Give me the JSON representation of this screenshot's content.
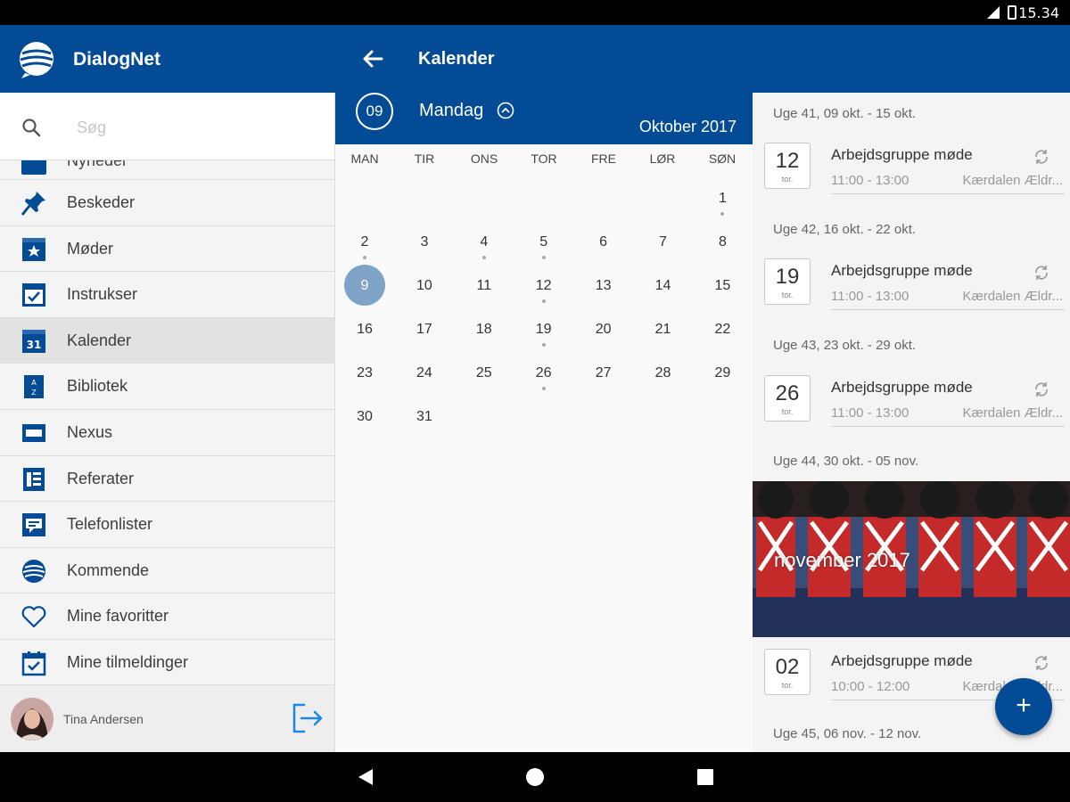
{
  "status_bar": {
    "time": "15.34"
  },
  "app_bar": {
    "app_name": "DialogNet",
    "screen_title": "Kalender"
  },
  "search": {
    "placeholder": "Søg"
  },
  "drawer": {
    "partial_item_label": "Nyheder",
    "items": [
      {
        "label": "Beskeder",
        "icon": "pin-icon"
      },
      {
        "label": "Møder",
        "icon": "meeting-icon"
      },
      {
        "label": "Instrukser",
        "icon": "checklist-icon"
      },
      {
        "label": "Kalender",
        "icon": "calendar-icon",
        "active": true
      },
      {
        "label": "Bibliotek",
        "icon": "library-icon"
      },
      {
        "label": "Nexus",
        "icon": "nexus-icon"
      },
      {
        "label": "Referater",
        "icon": "minutes-icon"
      },
      {
        "label": "Telefonlister",
        "icon": "phone-list-icon"
      },
      {
        "label": "Kommende",
        "icon": "upcoming-icon"
      },
      {
        "label": "Mine favoritter",
        "icon": "heart-icon"
      },
      {
        "label": "Mine tilmeldinger",
        "icon": "calendar-check-icon"
      }
    ],
    "user": {
      "name": "Tina Andersen"
    }
  },
  "calendar": {
    "selected_day_number": "09",
    "selected_day_name": "Mandag",
    "month_label": "Oktober 2017",
    "weekdays": [
      "MAN",
      "TIR",
      "ONS",
      "TOR",
      "FRE",
      "LØR",
      "SØN"
    ],
    "days": [
      {
        "n": "1",
        "dot": true
      },
      {
        "n": "2",
        "dot": true
      },
      {
        "n": "3"
      },
      {
        "n": "4",
        "dot": true
      },
      {
        "n": "5",
        "dot": true
      },
      {
        "n": "6"
      },
      {
        "n": "7"
      },
      {
        "n": "8"
      },
      {
        "n": "9",
        "selected": true
      },
      {
        "n": "10"
      },
      {
        "n": "11"
      },
      {
        "n": "12",
        "dot": true
      },
      {
        "n": "13"
      },
      {
        "n": "14"
      },
      {
        "n": "15"
      },
      {
        "n": "16"
      },
      {
        "n": "17"
      },
      {
        "n": "18"
      },
      {
        "n": "19",
        "dot": true
      },
      {
        "n": "20"
      },
      {
        "n": "21"
      },
      {
        "n": "22"
      },
      {
        "n": "23"
      },
      {
        "n": "24"
      },
      {
        "n": "25"
      },
      {
        "n": "26",
        "dot": true
      },
      {
        "n": "27"
      },
      {
        "n": "28"
      },
      {
        "n": "29"
      },
      {
        "n": "30"
      },
      {
        "n": "31"
      }
    ]
  },
  "events": {
    "weeks": [
      {
        "header": "Uge 41, 09 okt. - 15 okt.",
        "event": {
          "day": "12",
          "weekday": "tor.",
          "title": "Arbejdsgruppe møde",
          "time": "11:00 - 13:00",
          "location": "Kærdalen Ældr..."
        }
      },
      {
        "header": "Uge 42, 16 okt. - 22 okt.",
        "event": {
          "day": "19",
          "weekday": "tor.",
          "title": "Arbejdsgruppe møde",
          "time": "11:00 - 13:00",
          "location": "Kærdalen Ældr..."
        }
      },
      {
        "header": "Uge 43, 23 okt. - 29 okt.",
        "event": {
          "day": "26",
          "weekday": "tor.",
          "title": "Arbejdsgruppe møde",
          "time": "11:00 - 13:00",
          "location": "Kærdalen Ældr..."
        }
      },
      {
        "header": "Uge 44, 30 okt. - 05 nov.",
        "event": {
          "day": "02",
          "weekday": "tor.",
          "title": "Arbejdsgruppe møde",
          "time": "10:00 - 12:00",
          "location": "Kærdalen Ældr..."
        }
      }
    ],
    "month_banner": "november 2017",
    "next_week_header": "Uge 45, 06 nov. - 12 nov."
  },
  "fab": {
    "label": "+"
  },
  "colors": {
    "primary": "#034b94",
    "selected_day": "#7fa2c7"
  }
}
